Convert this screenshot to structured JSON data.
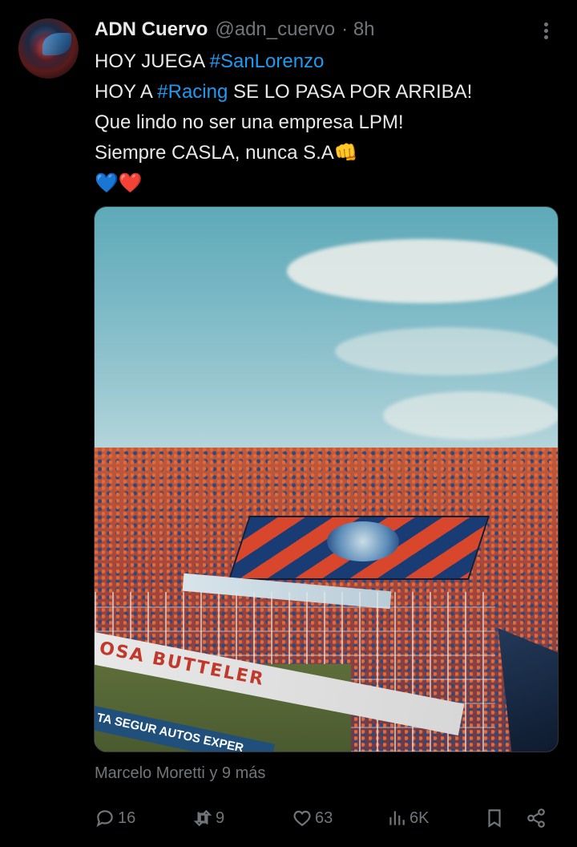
{
  "tweet": {
    "author_name": "ADN Cuervo",
    "handle": "@adn_cuervo",
    "time": "· 8h",
    "lines": [
      [
        "HOY JUEGA ",
        "#SanLorenzo"
      ],
      [
        "HOY A ",
        "#Racing",
        " SE LO PASA POR ARRIBA!"
      ],
      [
        "Que lindo no ser una empresa LPM!"
      ],
      [
        "Siempre CASLA, nunca S.A",
        "👊"
      ],
      [
        "💙❤️"
      ]
    ],
    "media": {
      "adboard_text": "OSA BUTTELER",
      "side_text": "TA SEGUR AUTOS EXPER"
    },
    "likers": "Marcelo Moretti y 9 más"
  },
  "actions": {
    "replies": "16",
    "retweets": "9",
    "likes": "63",
    "views": "6K"
  },
  "icons": {
    "avatar": "raven-avatar",
    "more": "more-vertical-icon",
    "reply": "reply-icon",
    "retweet": "retweet-icon",
    "like": "heart-icon",
    "views": "views-icon",
    "bookmark": "bookmark-icon",
    "share": "share-icon"
  },
  "colors": {
    "background": "#000000",
    "text": "#e7e9ea",
    "secondary": "#71767b",
    "link": "#1d9bf0"
  }
}
